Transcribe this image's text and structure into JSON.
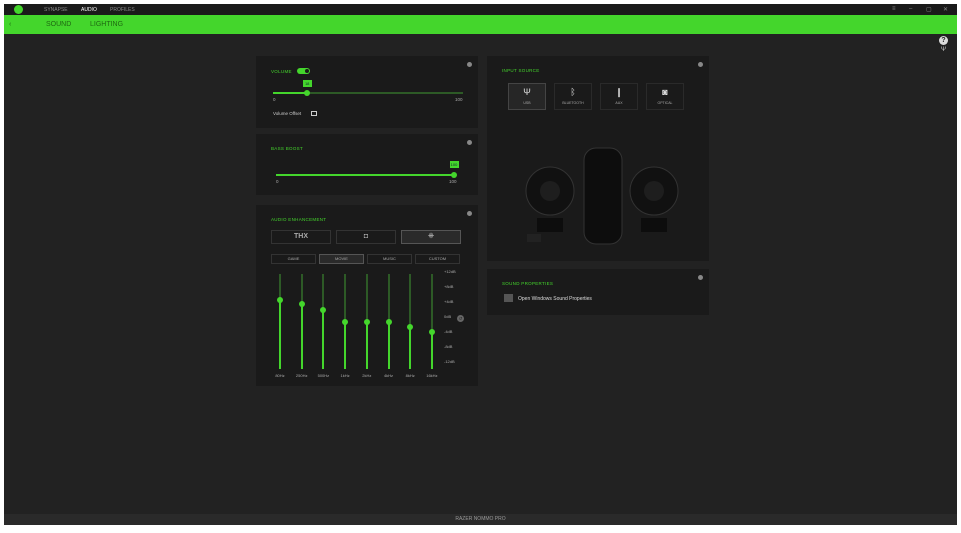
{
  "app": {
    "top_nav": [
      "SYNAPSE",
      "AUDIO",
      "PROFILES"
    ],
    "active_nav": "AUDIO",
    "tabs": [
      "SOUND",
      "LIGHTING"
    ],
    "window_controls": [
      "≡",
      "–",
      "▢",
      "✕"
    ],
    "help": "?",
    "device_name": "RAZER NOMMO PRO",
    "accent": "#44d62c"
  },
  "volume": {
    "title": "VOLUME",
    "value": 18,
    "value_label": "18",
    "min": "0",
    "max": "100",
    "volume_offset_label": "Volume Offset",
    "enabled": true
  },
  "bass_boost": {
    "title": "BASS BOOST",
    "value": 100,
    "value_label": "100",
    "min": "0",
    "max": "100"
  },
  "audio_enhancement": {
    "title": "AUDIO ENHANCEMENT",
    "modes": [
      "THX",
      "DOLBY",
      "STEREO"
    ],
    "mode_icons": [
      "THX",
      "◘",
      "⁜"
    ],
    "selected_mode": 2,
    "presets": [
      "GAME",
      "MOVIE",
      "MUSIC",
      "CUSTOM"
    ],
    "selected_preset": 1,
    "eq": {
      "bands": [
        "80Hz",
        "250Hz",
        "500Hz",
        "1kHz",
        "2kHz",
        "4kHz",
        "8kHz",
        "16kHz"
      ],
      "values_db": [
        5.5,
        4.3,
        3,
        0,
        0,
        0,
        -1.3,
        -2.6
      ],
      "scale": [
        "+12dB",
        "+8dB",
        "+4dB",
        "0dB",
        "-4dB",
        "-8dB",
        "-12dB"
      ],
      "range": [
        -12,
        12
      ]
    }
  },
  "input_source": {
    "title": "INPUT SOURCE",
    "sources": [
      {
        "label": "USB",
        "icon": "usb-icon",
        "glyph": "Ψ"
      },
      {
        "label": "BLUETOOTH",
        "icon": "bluetooth-icon",
        "glyph": "ᛒ"
      },
      {
        "label": "AUX",
        "icon": "aux-icon",
        "glyph": "❙"
      },
      {
        "label": "OPTICAL",
        "icon": "optical-icon",
        "glyph": "◙"
      }
    ],
    "selected": 0
  },
  "sound_properties": {
    "title": "SOUND PROPERTIES",
    "link": "Open Windows Sound Properties"
  }
}
